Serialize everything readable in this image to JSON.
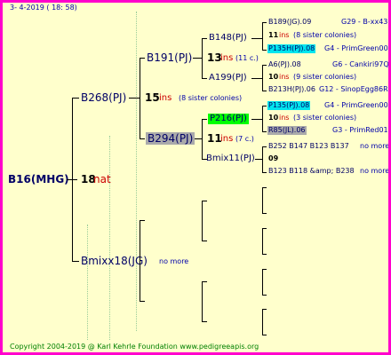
{
  "date_line": "3-   4-2019  ( 18:  58)",
  "footer": "Copyright 2004-2019 @ Karl Kehrle Foundation   www.pedigreeapis.org",
  "colors": {
    "border": "#ff00cc",
    "background": "#ffffcc",
    "cyan": "#00e5ee",
    "green_hl": "#00ff00",
    "grey_hl": "#aaaaaa",
    "dots": "#99cc99"
  },
  "g1": {
    "name": "B16(MHG)",
    "num": "18",
    "tag": "nat"
  },
  "g2_top": {
    "name": "B268(PJ)",
    "num": "15",
    "tag": "ins",
    "note": "(8 sister colonies)"
  },
  "g2_bot": {
    "name": "Bmixx18(JG)",
    "note": "no more"
  },
  "g3a": {
    "name": "B191(PJ)",
    "num": "13",
    "tag": "ins",
    "note": "(11 c.)"
  },
  "g3b": {
    "name": "B294(PJ)",
    "num": "11",
    "tag": "ins",
    "note": "(7 c.)"
  },
  "g4a": {
    "name": "B148(PJ)"
  },
  "g4b": {
    "name": "A199(PJ)"
  },
  "g4c": {
    "name": "P216(PJ)"
  },
  "g4d": {
    "name": "Bmix11(PJ)"
  },
  "g5": [
    {
      "name": "B189(JG).09",
      "right": "G29 - B-xx43"
    },
    {
      "num": "11",
      "tag": "ins",
      "note": "(8 sister colonies)"
    },
    {
      "name": "P135H(PJ).08",
      "right": "G4 - PrimGreen00"
    },
    {
      "name": "A6(PJ).08",
      "right": "G6 - Cankiri97Q"
    },
    {
      "num": "10",
      "tag": "ins",
      "note": "(9 sister colonies)"
    },
    {
      "name": "B213H(PJ).06",
      "right": "G12 - SinopEgg86R"
    },
    {
      "name": "P135(PJ).08",
      "right": "G4 - PrimGreen00"
    },
    {
      "num": "10",
      "tag": "ins",
      "note": "(3 sister colonies)"
    },
    {
      "name": "R85(JL).06",
      "right": "G3 - PrimRed01"
    },
    {
      "name": "B252 B147 B123 B137",
      "right": "no more"
    },
    {
      "num": "09"
    },
    {
      "name": "B123 B118 &amp; B238",
      "right": "no more"
    }
  ]
}
